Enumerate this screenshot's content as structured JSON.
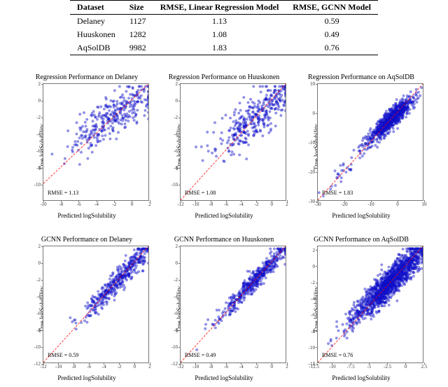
{
  "table": {
    "headers": [
      "Dataset",
      "Size",
      "RMSE, Linear Regression Model",
      "RMSE, GCNN Model"
    ],
    "rows": [
      {
        "dataset": "Delaney",
        "size": "1127",
        "lin": "1.13",
        "gcnn": "0.59"
      },
      {
        "dataset": "Huuskonen",
        "size": "1282",
        "lin": "1.08",
        "gcnn": "0.49"
      },
      {
        "dataset": "AqSolDB",
        "size": "9982",
        "lin": "1.83",
        "gcnn": "0.76"
      }
    ]
  },
  "axis": {
    "ylabel": "True logSolubility",
    "xlabel": "Predicted logSolubility"
  },
  "charts": [
    {
      "title": "Regression Performance on Delaney",
      "rmse": "RMSE = 1.13",
      "xr": [
        -10,
        2
      ],
      "yr": [
        -12,
        2
      ],
      "xticks": [
        -10,
        -8,
        -6,
        -4,
        -2,
        0,
        2
      ],
      "yticks": [
        -10,
        -8,
        -6,
        -4,
        -2,
        0,
        2
      ],
      "spread": 1.6,
      "seed": 1,
      "n": 320
    },
    {
      "title": "Regression Performance on Huuskonen",
      "rmse": "RMSE = 1.08",
      "xr": [
        -12,
        2
      ],
      "yr": [
        -12,
        2
      ],
      "xticks": [
        -12,
        -10,
        -8,
        -6,
        -4,
        -2,
        0,
        2
      ],
      "yticks": [
        -10,
        -8,
        -6,
        -4,
        -2,
        0,
        2
      ],
      "spread": 1.5,
      "seed": 2,
      "n": 360
    },
    {
      "title": "Regression Performance on AqSolDB",
      "rmse": "RMSE = 1.83",
      "xr": [
        -30,
        10
      ],
      "yr": [
        -30,
        10
      ],
      "xticks": [
        -30,
        -20,
        -10,
        0,
        10
      ],
      "yticks": [
        -30,
        -20,
        -10,
        0,
        10
      ],
      "spread": 1.8,
      "seed": 3,
      "n": 900,
      "cluster": true
    },
    {
      "title": "GCNN Performance on Delaney",
      "rmse": "RMSE = 0.59",
      "xr": [
        -12,
        2
      ],
      "yr": [
        -12,
        2
      ],
      "xticks": [
        -12,
        -10,
        -8,
        -6,
        -4,
        -2,
        0,
        2
      ],
      "yticks": [
        -12,
        -10,
        -8,
        -6,
        -4,
        -2,
        0,
        2
      ],
      "spread": 0.75,
      "seed": 4,
      "n": 420
    },
    {
      "title": "GCNN Performance on Huuskonen",
      "rmse": "RMSE = 0.49",
      "xr": [
        -12,
        2
      ],
      "yr": [
        -12,
        2
      ],
      "xticks": [
        -12,
        -10,
        -8,
        -6,
        -4,
        -2,
        0,
        2
      ],
      "yticks": [
        -12,
        -10,
        -8,
        -6,
        -4,
        -2,
        0,
        2
      ],
      "spread": 0.65,
      "seed": 5,
      "n": 460
    },
    {
      "title": "GCNN Performance on AqSolDB",
      "rmse": "RMSE = 0.76",
      "xr": [
        -12,
        2.5
      ],
      "yr": [
        -12,
        2.5
      ],
      "xticks": [
        -12.5,
        -10,
        -7.5,
        -5,
        -2.5,
        0,
        2.5
      ],
      "yticks": [
        -12,
        -10,
        -8,
        -6,
        -4,
        -2,
        0,
        2
      ],
      "spread": 1.0,
      "seed": 6,
      "n": 1400
    }
  ],
  "chart_data": {
    "type": "scatter",
    "note": "Predicted vs true logSolubility scatter plots with y=x reference line; RMSE annotated per panel.",
    "panels": [
      {
        "title": "Regression Performance on Delaney",
        "xlabel": "Predicted logSolubility",
        "ylabel": "True logSolubility",
        "xlim": [
          -10,
          2
        ],
        "ylim": [
          -12,
          2
        ],
        "rmse": 1.13
      },
      {
        "title": "Regression Performance on Huuskonen",
        "xlabel": "Predicted logSolubility",
        "ylabel": "True logSolubility",
        "xlim": [
          -12,
          2
        ],
        "ylim": [
          -12,
          2
        ],
        "rmse": 1.08
      },
      {
        "title": "Regression Performance on AqSolDB",
        "xlabel": "Predicted logSolubility",
        "ylabel": "True logSolubility",
        "xlim": [
          -30,
          10
        ],
        "ylim": [
          -30,
          10
        ],
        "rmse": 1.83
      },
      {
        "title": "GCNN Performance on Delaney",
        "xlabel": "Predicted logSolubility",
        "ylabel": "True logSolubility",
        "xlim": [
          -12,
          2
        ],
        "ylim": [
          -12,
          2
        ],
        "rmse": 0.59
      },
      {
        "title": "GCNN Performance on Huuskonen",
        "xlabel": "Predicted logSolubility",
        "ylabel": "True logSolubility",
        "xlim": [
          -12,
          2
        ],
        "ylim": [
          -12,
          2
        ],
        "rmse": 0.49
      },
      {
        "title": "GCNN Performance on AqSolDB",
        "xlabel": "Predicted logSolubility",
        "ylabel": "True logSolubility",
        "xlim": [
          -12.5,
          2.5
        ],
        "ylim": [
          -12.5,
          2.5
        ],
        "rmse": 0.76
      }
    ]
  }
}
